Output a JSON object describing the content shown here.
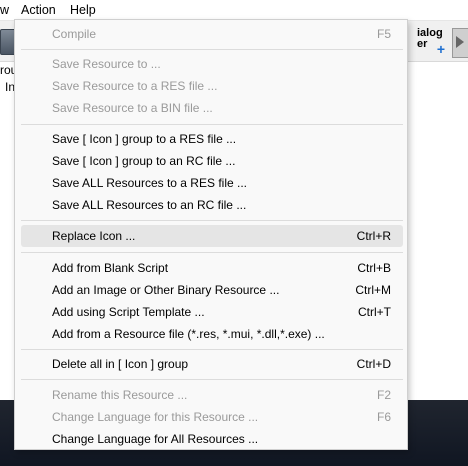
{
  "menubar": {
    "items": [
      "w",
      "Action",
      "Help"
    ]
  },
  "toolbar": {
    "dialog_label_1": "ialog",
    "dialog_label_2": "er"
  },
  "background_text": {
    "line1": "rou",
    "line2": "In"
  },
  "menu": {
    "items": [
      {
        "label": "Compile",
        "shortcut": "F5",
        "enabled": false
      },
      {
        "label": "Save Resource to ...",
        "shortcut": "",
        "enabled": false
      },
      {
        "label": "Save Resource to a RES file ...",
        "shortcut": "",
        "enabled": false
      },
      {
        "label": "Save Resource to a BIN file ...",
        "shortcut": "",
        "enabled": false
      },
      {
        "label": "Save [ Icon ] group to a RES file ...",
        "shortcut": "",
        "enabled": true
      },
      {
        "label": "Save [ Icon ] group to an RC file ...",
        "shortcut": "",
        "enabled": true
      },
      {
        "label": "Save ALL Resources to a RES file ...",
        "shortcut": "",
        "enabled": true
      },
      {
        "label": "Save ALL Resources to an RC file ...",
        "shortcut": "",
        "enabled": true
      },
      {
        "label": "Replace Icon ...",
        "shortcut": "Ctrl+R",
        "enabled": true,
        "highlighted": true
      },
      {
        "label": "Add from Blank Script",
        "shortcut": "Ctrl+B",
        "enabled": true
      },
      {
        "label": "Add an Image or Other Binary Resource ...",
        "shortcut": "Ctrl+M",
        "enabled": true
      },
      {
        "label": "Add using Script Template ...",
        "shortcut": "Ctrl+T",
        "enabled": true
      },
      {
        "label": "Add from a Resource file (*.res, *.mui, *.dll,*.exe) ...",
        "shortcut": "",
        "enabled": true
      },
      {
        "label": "Delete all in [ Icon ] group",
        "shortcut": "Ctrl+D",
        "enabled": true
      },
      {
        "label": "Rename this Resource ...",
        "shortcut": "F2",
        "enabled": false
      },
      {
        "label": "Change Language for this Resource ...",
        "shortcut": "F6",
        "enabled": false
      },
      {
        "label": "Change Language for All Resources ...",
        "shortcut": "",
        "enabled": true
      }
    ]
  }
}
